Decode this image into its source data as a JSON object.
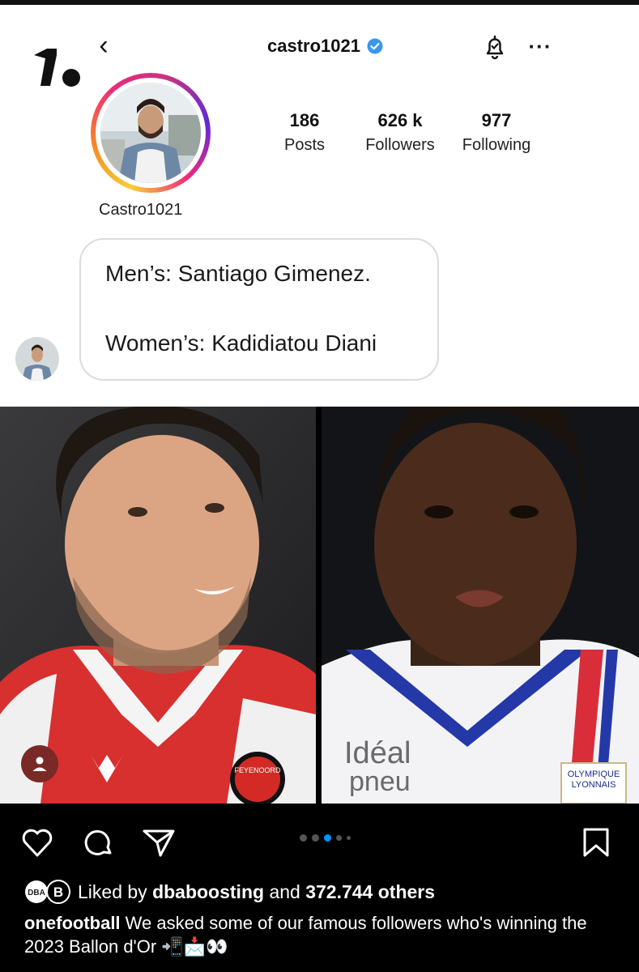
{
  "header": {
    "back_glyph": "‹",
    "handle": "castro1021",
    "more_glyph": "···"
  },
  "profile": {
    "display_name": "Castro1021",
    "stats": [
      {
        "value": "186",
        "label": "Posts"
      },
      {
        "value": "626 k",
        "label": "Followers"
      },
      {
        "value": "977",
        "label": "Following"
      }
    ]
  },
  "bubble": {
    "line1": "Men’s: Santiago Gimenez.",
    "line2": "Women’s: Kadidiatou Diani"
  },
  "photos": {
    "left_badge": "FEYENOORD",
    "right_sponsor1": "Idéal",
    "right_sponsor2": "pneu",
    "right_club1": "OLYMPIQUE",
    "right_club2": "LYONNAIS"
  },
  "carousel": {
    "count": 5,
    "active_index": 2
  },
  "likes": {
    "prefix": "Liked by",
    "user": "dbaboosting",
    "middle": "and",
    "others": "372.744 others"
  },
  "caption": {
    "username": "onefootball",
    "text": "We asked some of our famous followers who's winning the 2023 Ballon d'Or 📲📩👀"
  },
  "colors": {
    "accent": "#0095f6",
    "verified": "#3897f0",
    "user_tag": "#7a2a26"
  }
}
